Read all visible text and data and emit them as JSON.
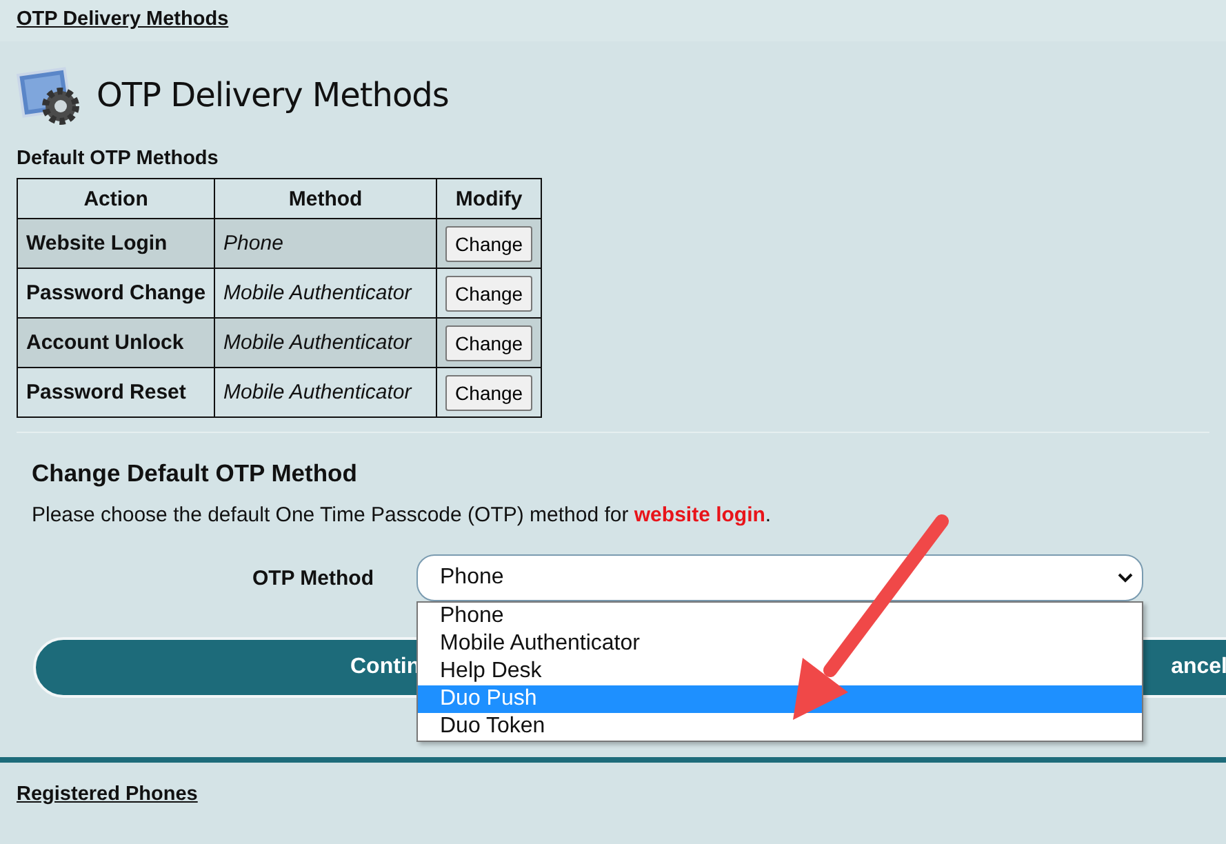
{
  "breadcrumb": "OTP Delivery Methods",
  "page_title": "OTP Delivery Methods",
  "table": {
    "caption": "Default OTP Methods",
    "columns": [
      "Action",
      "Method",
      "Modify"
    ],
    "rows": [
      {
        "action": "Website Login",
        "method": "Phone",
        "button": "Change"
      },
      {
        "action": "Password Change",
        "method": "Mobile Authenticator",
        "button": "Change"
      },
      {
        "action": "Account Unlock",
        "method": "Mobile Authenticator",
        "button": "Change"
      },
      {
        "action": "Password Reset",
        "method": "Mobile Authenticator",
        "button": "Change"
      }
    ]
  },
  "change_panel": {
    "title": "Change Default OTP Method",
    "instruction": "Please choose the default One Time Passcode (OTP) method for **website login**.",
    "field": {
      "label": "OTP Method",
      "value": "Phone",
      "expanded": true,
      "options": [
        {
          "label": "Phone",
          "highlighted": false
        },
        {
          "label": "Mobile Authenticator",
          "highlighted": false
        },
        {
          "label": "Help Desk",
          "highlighted": false
        },
        {
          "label": "Duo Push",
          "highlighted": true
        },
        {
          "label": "Duo Token",
          "highlighted": false
        }
      ]
    },
    "buttons": [
      "Contin",
      "ancel"
    ]
  },
  "footer_link": "Registered Phones"
}
